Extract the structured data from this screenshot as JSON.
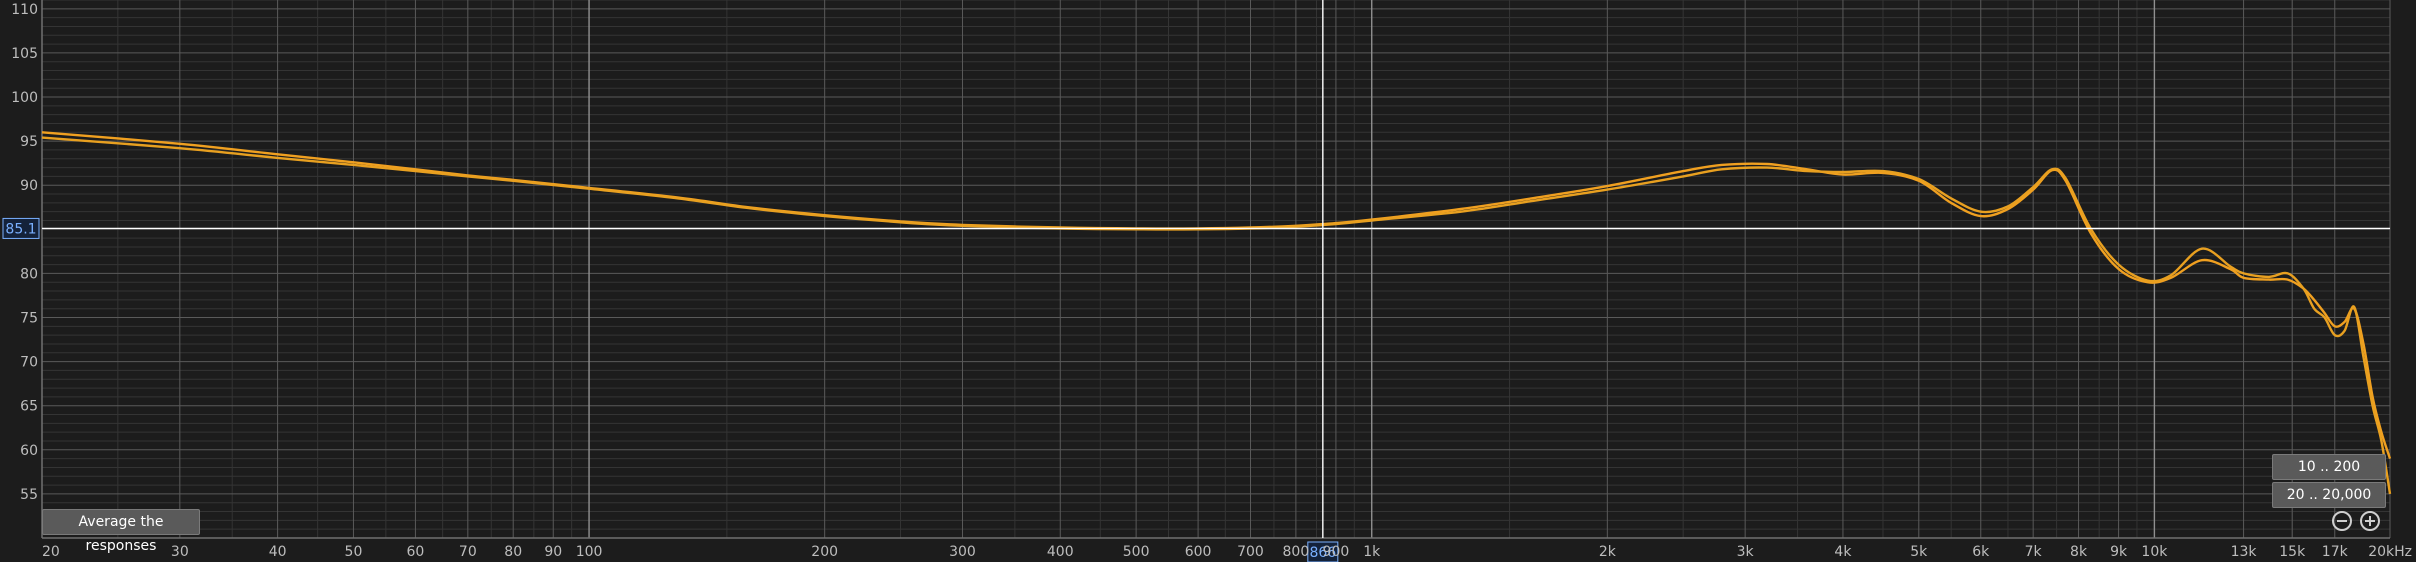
{
  "chart_data": {
    "type": "line",
    "xscale": "log",
    "xlim": [
      20,
      20000
    ],
    "ylim": [
      50,
      111
    ],
    "grid": true,
    "x_ticks": [
      {
        "v": 20,
        "label": "20"
      },
      {
        "v": 30,
        "label": "30"
      },
      {
        "v": 40,
        "label": "40"
      },
      {
        "v": 50,
        "label": "50"
      },
      {
        "v": 60,
        "label": "60"
      },
      {
        "v": 70,
        "label": "70"
      },
      {
        "v": 80,
        "label": "80"
      },
      {
        "v": 90,
        "label": "90"
      },
      {
        "v": 100,
        "label": "100"
      },
      {
        "v": 200,
        "label": "200"
      },
      {
        "v": 300,
        "label": "300"
      },
      {
        "v": 400,
        "label": "400"
      },
      {
        "v": 500,
        "label": "500"
      },
      {
        "v": 600,
        "label": "600"
      },
      {
        "v": 700,
        "label": "700"
      },
      {
        "v": 800,
        "label": "800"
      },
      {
        "v": 900,
        "label": "900"
      },
      {
        "v": 1000,
        "label": "1k"
      },
      {
        "v": 2000,
        "label": "2k"
      },
      {
        "v": 3000,
        "label": "3k"
      },
      {
        "v": 4000,
        "label": "4k"
      },
      {
        "v": 5000,
        "label": "5k"
      },
      {
        "v": 6000,
        "label": "6k"
      },
      {
        "v": 7000,
        "label": "7k"
      },
      {
        "v": 8000,
        "label": "8k"
      },
      {
        "v": 9000,
        "label": "9k"
      },
      {
        "v": 10000,
        "label": "10k"
      },
      {
        "v": 13000,
        "label": "13k"
      },
      {
        "v": 15000,
        "label": "15k"
      },
      {
        "v": 17000,
        "label": "17k"
      },
      {
        "v": 20000,
        "label": "20kHz"
      }
    ],
    "y_ticks": [
      {
        "v": 55,
        "label": "55"
      },
      {
        "v": 60,
        "label": "60"
      },
      {
        "v": 65,
        "label": "65"
      },
      {
        "v": 70,
        "label": "70"
      },
      {
        "v": 75,
        "label": "75"
      },
      {
        "v": 80,
        "label": "80"
      },
      {
        "v": 90,
        "label": "90"
      },
      {
        "v": 95,
        "label": "95"
      },
      {
        "v": 100,
        "label": "100"
      },
      {
        "v": 105,
        "label": "105"
      },
      {
        "v": 110,
        "label": "110"
      }
    ],
    "cursor": {
      "x": 866,
      "y": 85.1,
      "x_label": "866",
      "y_label": "85.1"
    },
    "series": [
      {
        "color": "#f0a020",
        "points": [
          [
            20,
            96.0
          ],
          [
            30,
            94.7
          ],
          [
            40,
            93.5
          ],
          [
            50,
            92.6
          ],
          [
            60,
            91.8
          ],
          [
            70,
            91.1
          ],
          [
            80,
            90.6
          ],
          [
            100,
            89.7
          ],
          [
            130,
            88.6
          ],
          [
            160,
            87.5
          ],
          [
            200,
            86.6
          ],
          [
            250,
            85.9
          ],
          [
            300,
            85.5
          ],
          [
            400,
            85.2
          ],
          [
            500,
            85.1
          ],
          [
            600,
            85.1
          ],
          [
            700,
            85.2
          ],
          [
            800,
            85.4
          ],
          [
            900,
            85.7
          ],
          [
            1000,
            86.1
          ],
          [
            1300,
            87.3
          ],
          [
            1600,
            88.5
          ],
          [
            2000,
            89.9
          ],
          [
            2500,
            91.6
          ],
          [
            2800,
            92.3
          ],
          [
            3200,
            92.4
          ],
          [
            3600,
            91.8
          ],
          [
            4000,
            91.2
          ],
          [
            4500,
            91.4
          ],
          [
            5000,
            90.5
          ],
          [
            5500,
            88.0
          ],
          [
            6000,
            86.5
          ],
          [
            6500,
            87.3
          ],
          [
            7000,
            89.5
          ],
          [
            7400,
            91.7
          ],
          [
            7700,
            90.5
          ],
          [
            8300,
            84.5
          ],
          [
            9000,
            80.5
          ],
          [
            9800,
            79.0
          ],
          [
            10500,
            79.5
          ],
          [
            11500,
            81.5
          ],
          [
            12500,
            80.5
          ],
          [
            13000,
            79.5
          ],
          [
            14000,
            79.3
          ],
          [
            14800,
            79.3
          ],
          [
            15500,
            78.3
          ],
          [
            16000,
            77.0
          ],
          [
            16500,
            75.5
          ],
          [
            17000,
            74.0
          ],
          [
            17500,
            74.5
          ],
          [
            18000,
            76.0
          ],
          [
            18500,
            72.0
          ],
          [
            19000,
            66.0
          ],
          [
            19500,
            62.0
          ],
          [
            20000,
            59.0
          ]
        ]
      },
      {
        "color": "#e8a020",
        "points": [
          [
            20,
            95.4
          ],
          [
            30,
            94.2
          ],
          [
            40,
            93.1
          ],
          [
            50,
            92.3
          ],
          [
            60,
            91.6
          ],
          [
            70,
            91.0
          ],
          [
            80,
            90.5
          ],
          [
            100,
            89.6
          ],
          [
            130,
            88.5
          ],
          [
            160,
            87.4
          ],
          [
            200,
            86.5
          ],
          [
            250,
            85.8
          ],
          [
            300,
            85.4
          ],
          [
            400,
            85.1
          ],
          [
            500,
            85.0
          ],
          [
            600,
            85.0
          ],
          [
            700,
            85.1
          ],
          [
            800,
            85.3
          ],
          [
            900,
            85.6
          ],
          [
            1000,
            86.0
          ],
          [
            1300,
            87.0
          ],
          [
            1600,
            88.2
          ],
          [
            2000,
            89.5
          ],
          [
            2500,
            91.0
          ],
          [
            2800,
            91.8
          ],
          [
            3200,
            92.0
          ],
          [
            3600,
            91.6
          ],
          [
            4000,
            91.5
          ],
          [
            4500,
            91.6
          ],
          [
            5000,
            90.7
          ],
          [
            5500,
            88.5
          ],
          [
            6000,
            87.0
          ],
          [
            6500,
            87.6
          ],
          [
            7000,
            89.8
          ],
          [
            7400,
            91.8
          ],
          [
            7700,
            90.8
          ],
          [
            8300,
            85.0
          ],
          [
            9000,
            81.0
          ],
          [
            9800,
            79.2
          ],
          [
            10500,
            79.8
          ],
          [
            11500,
            82.8
          ],
          [
            12500,
            80.8
          ],
          [
            13000,
            80.0
          ],
          [
            14000,
            79.6
          ],
          [
            14800,
            80.0
          ],
          [
            15500,
            78.3
          ],
          [
            16000,
            76.0
          ],
          [
            16500,
            75.0
          ],
          [
            17000,
            73.0
          ],
          [
            17500,
            73.5
          ],
          [
            18000,
            76.2
          ],
          [
            18500,
            70.5
          ],
          [
            19000,
            65.0
          ],
          [
            19500,
            61.0
          ],
          [
            20000,
            55.0
          ]
        ]
      }
    ]
  },
  "buttons": {
    "average": "Average the responses",
    "range_1": "10 .. 200",
    "range_2": "20 .. 20,000"
  },
  "colors": {
    "background": "#1c1c1c",
    "grid_major": "#5a5a5a",
    "grid_minor": "#343434",
    "cursor": "#ffffff",
    "cursor_label": "#7ab0ff"
  }
}
